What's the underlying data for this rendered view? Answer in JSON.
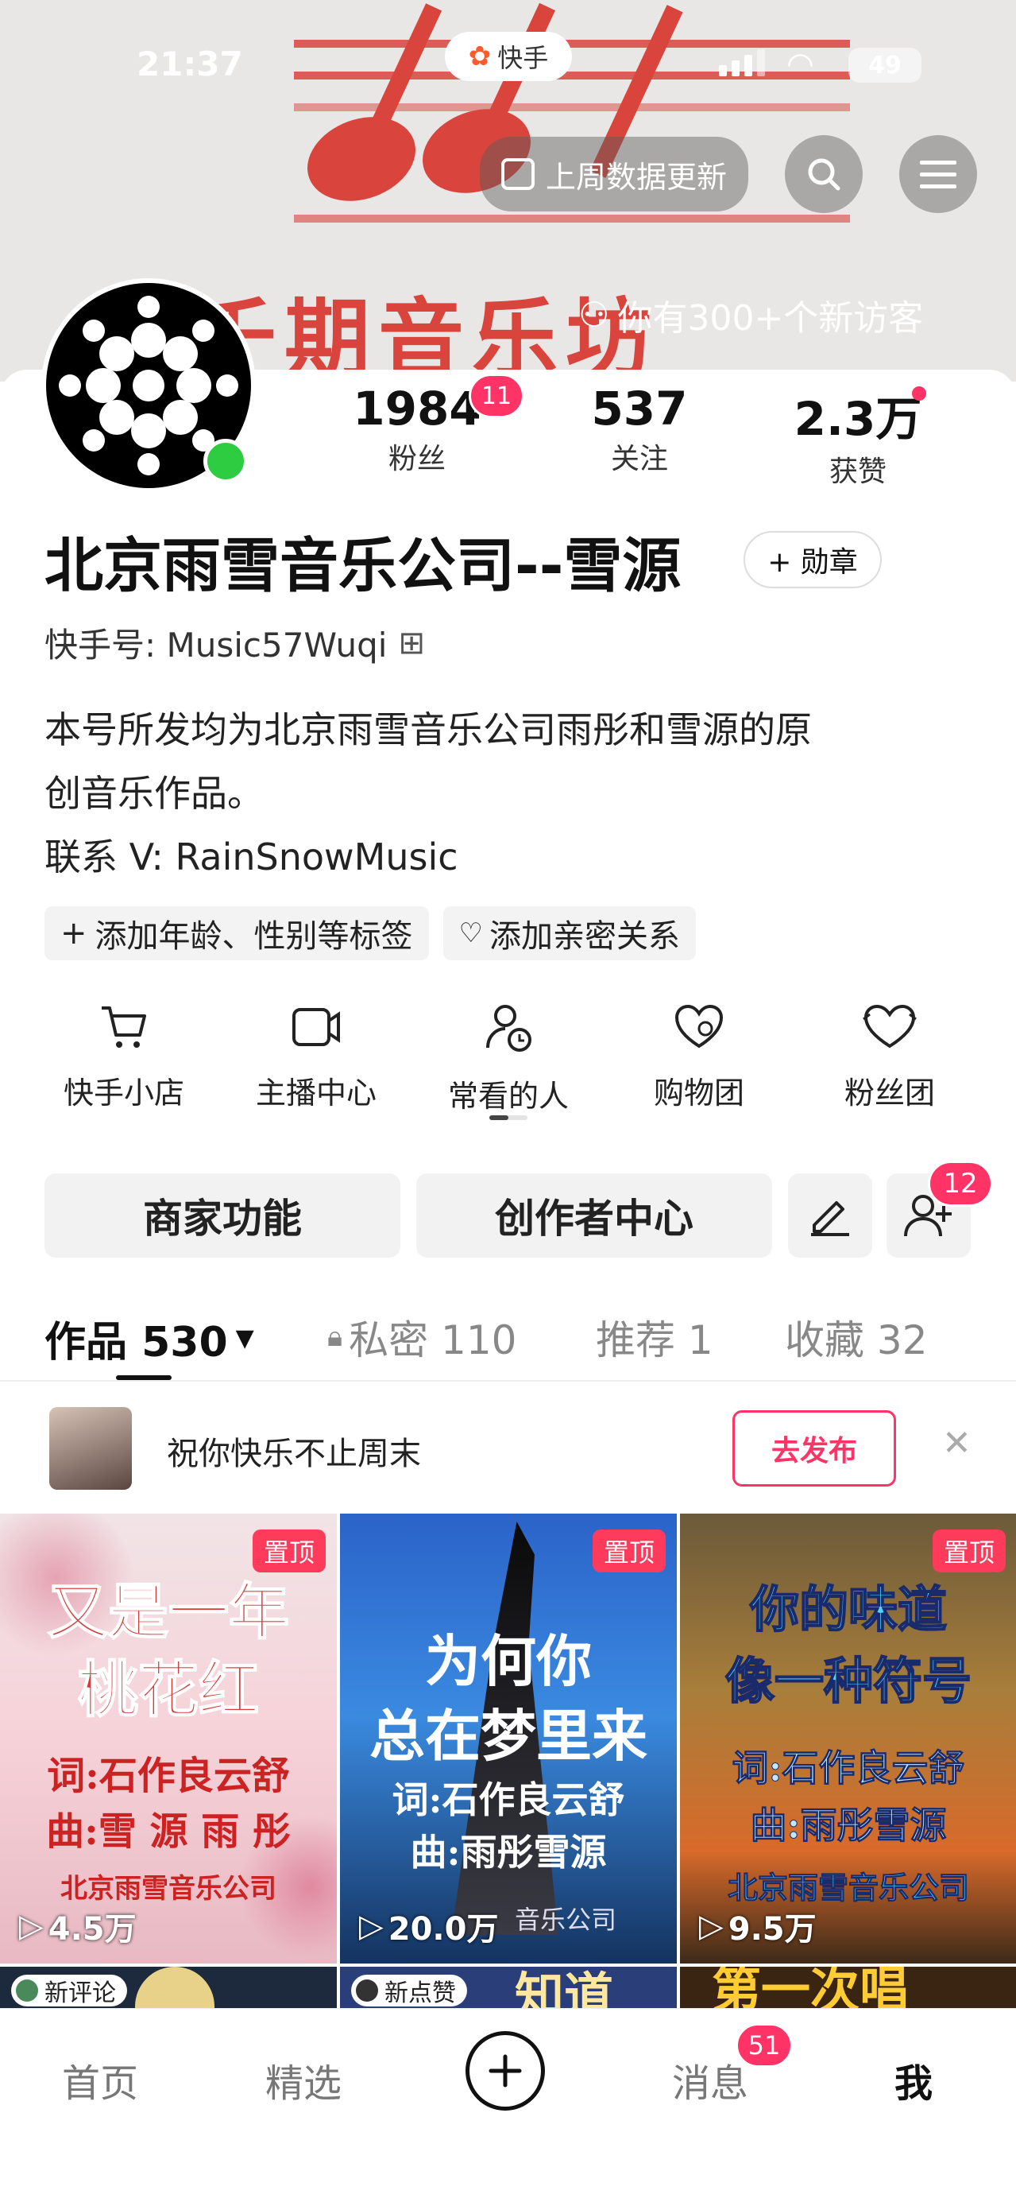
{
  "status_bar": {
    "time": "21:37",
    "battery": "49"
  },
  "banner": {
    "app_pill": "快手",
    "weekly_update": "上周数据更新",
    "visitors": "你有300+个新访客",
    "bg_text": "千期音乐坊"
  },
  "profile": {
    "stats": [
      {
        "value": "1984",
        "label": "粉丝",
        "badge": "11"
      },
      {
        "value": "537",
        "label": "关注"
      },
      {
        "value": "2.3万",
        "label": "获赞"
      }
    ],
    "name": "北京雨雪音乐公司--雪源",
    "medal_btn": "+ 勋章",
    "kuaishou_id": "快手号: Music57Wuqi",
    "bio_line1": "本号所发均为北京雨雪音乐公司雨彤和雪源的原",
    "bio_line2": "创音乐作品。",
    "contact": "联系 V:  RainSnowMusic",
    "tag_chips": [
      "添加年龄、性别等标签",
      "添加亲密关系"
    ]
  },
  "quick_actions": [
    {
      "label": "快手小店",
      "icon": "cart-icon"
    },
    {
      "label": "主播中心",
      "icon": "video-camera-icon"
    },
    {
      "label": "常看的人",
      "icon": "person-clock-icon"
    },
    {
      "label": "购物团",
      "icon": "heart-bag-icon"
    },
    {
      "label": "粉丝团",
      "icon": "heart-icon"
    }
  ],
  "action_buttons": {
    "merchant": "商家功能",
    "creator": "创作者中心",
    "friend_badge": "12"
  },
  "content_tabs": [
    {
      "label": "作品 530",
      "active": true
    },
    {
      "label": "私密 110"
    },
    {
      "label": "推荐 1"
    },
    {
      "label": "收藏 32"
    }
  ],
  "promo": {
    "text": "祝你快乐不止周末",
    "button": "去发布"
  },
  "videos": [
    {
      "pin": "置顶",
      "title1": "又是一年",
      "title2": "桃花红",
      "line3": "词:石作良云舒",
      "line4": "曲:雪 源 雨 彤",
      "line5": "北京雨雪音乐公司",
      "views": "4.5万"
    },
    {
      "pin": "置顶",
      "title1": "为何你",
      "title2": "总在梦里来",
      "line3": "词:石作良云舒",
      "line4": "曲:雨彤雪源",
      "line5": "音乐公司",
      "views": "20.0万"
    },
    {
      "pin": "置顶",
      "title1": "你的味道",
      "title2": "像一种符号",
      "line3": "词:石作良云舒",
      "line4": "曲:雨彤雪源",
      "line5": "北京雨雪音乐公司",
      "views": "9.5万"
    }
  ],
  "row2_labels": {
    "left": "新评论",
    "mid": "新点赞",
    "mid_title": "知道",
    "right_title": "第一次唱"
  },
  "bottom_nav": [
    {
      "label": "首页"
    },
    {
      "label": "精选"
    },
    {
      "label": "消息",
      "badge": "51"
    },
    {
      "label": "我",
      "active": true
    }
  ],
  "colors": {
    "accent": "#ff3366",
    "brand_red": "#d9443c",
    "online": "#2ecc40"
  }
}
